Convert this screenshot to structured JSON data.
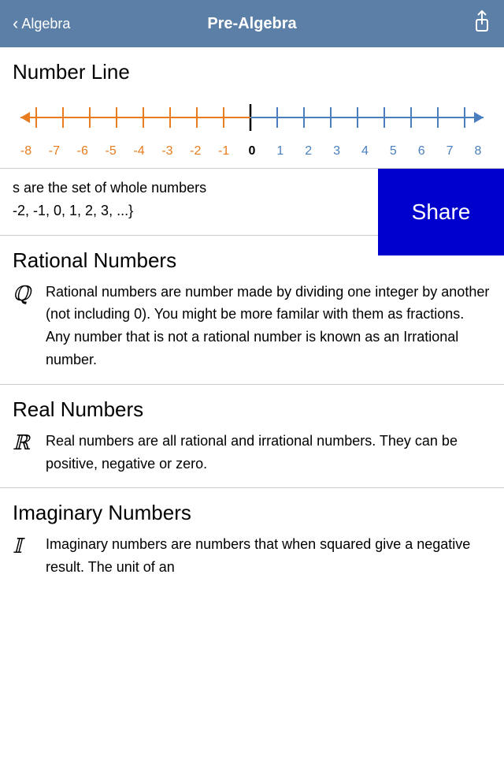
{
  "header": {
    "back_label": "Algebra",
    "title": "Pre-Algebra",
    "back_chevron": "‹",
    "share_icon": "⬆"
  },
  "number_line": {
    "section_title": "Number Line",
    "labels_negative": [
      "-8",
      "-7",
      "-6",
      "-5",
      "-4",
      "-3",
      "-2",
      "-1"
    ],
    "label_zero": "0",
    "labels_positive": [
      "1",
      "2",
      "3",
      "4",
      "5",
      "6",
      "7",
      "8"
    ]
  },
  "share_button": {
    "label": "Share"
  },
  "integers": {
    "text_line1": "s are the set of whole numbers",
    "text_line2": "-2, -1, 0, 1, 2, 3, ...}"
  },
  "sections": [
    {
      "id": "rational",
      "title": "Rational Numbers",
      "symbol": "ℚ",
      "text": "Rational numbers are number made by dividing one integer by another (not including 0). You might be more familar with them as fractions. Any number that is not a rational number is known as an Irrational number."
    },
    {
      "id": "real",
      "title": "Real Numbers",
      "symbol": "ℝ",
      "text": "Real numbers are all rational and irrational numbers. They can be positive, negative or zero."
    },
    {
      "id": "imaginary",
      "title": "Imaginary Numbers",
      "symbol": "𝕀",
      "text": "Imaginary numbers are numbers that when squared give a negative result. The unit of an"
    }
  ],
  "colors": {
    "header_bg": "#5b7fa6",
    "orange": "#e87c1e",
    "blue": "#4a7fbf",
    "share_bg": "#0000cc"
  }
}
